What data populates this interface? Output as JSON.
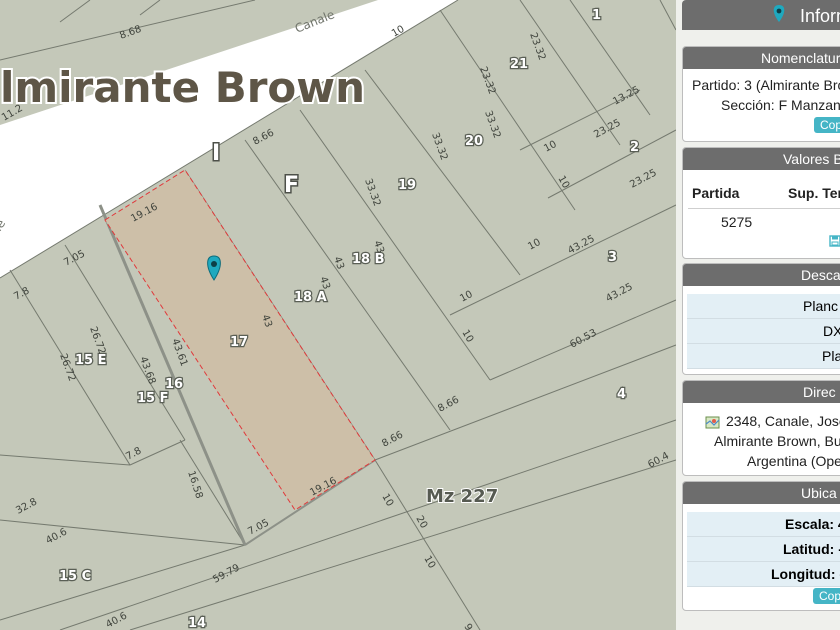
{
  "map": {
    "locality_label": "lmirante Brown",
    "section_label_i": "I",
    "section_label_f": "F",
    "block_label": "Mz 227",
    "street_label": "Canale",
    "street_label_2": "le",
    "selected_parcel": "17",
    "parcels": [
      {
        "label": "1"
      },
      {
        "label": "21"
      },
      {
        "label": "20"
      },
      {
        "label": "2"
      },
      {
        "label": "19"
      },
      {
        "label": "18 B"
      },
      {
        "label": "18 A"
      },
      {
        "label": "3"
      },
      {
        "label": "17"
      },
      {
        "label": "16"
      },
      {
        "label": "15 E"
      },
      {
        "label": "15 F"
      },
      {
        "label": "4"
      },
      {
        "label": "15 C"
      },
      {
        "label": "14"
      }
    ],
    "measures": [
      "11.2",
      "8.68",
      "10",
      "23.32",
      "23.32",
      "33.32",
      "13.25",
      "10",
      "23.25",
      "10",
      "23.25",
      "33.32",
      "8.66",
      "33.32",
      "19.16",
      "7.05",
      "43",
      "43",
      "43",
      "10",
      "43.25",
      "43.25",
      "10",
      "7.8",
      "26.72",
      "26.72",
      "43.68",
      "43.61",
      "43",
      "10",
      "60.53",
      "8.66",
      "8.66",
      "7.8",
      "16.58",
      "19.16",
      "10",
      "20",
      "10",
      "7.05",
      "32.8",
      "40.6",
      "59.79",
      "40.6",
      "60.4",
      "9"
    ]
  },
  "panel": {
    "title": "Inform",
    "nomenclatura": {
      "header": "Nomenclatur",
      "line1": "Partido: 3 (Almirante Bro",
      "line2": "Sección: F Manzana",
      "copy": "Cop"
    },
    "valores": {
      "header": "Valores B",
      "col1": "Partida",
      "col2": "Sup. Ter",
      "partida": "5275"
    },
    "descarga": {
      "header": "Desca",
      "items": [
        "Planc",
        "DX",
        "Plan"
      ]
    },
    "direccion": {
      "header": "Direc",
      "line1": "2348, Canale, Jose",
      "line2": "Almirante Brown, Bu",
      "line3": "Argentina (Ope"
    },
    "ubicacion": {
      "header": "Ubica",
      "escala": "Escala: 4",
      "latitud": "Latitud: -",
      "longitud": "Longitud: -",
      "copy": "Cop"
    },
    "colors": {
      "accent": "#45b5c6",
      "header": "#6d6d6d",
      "selected_fill": "#cdbfa8",
      "selected_border": "#e0393b"
    }
  }
}
